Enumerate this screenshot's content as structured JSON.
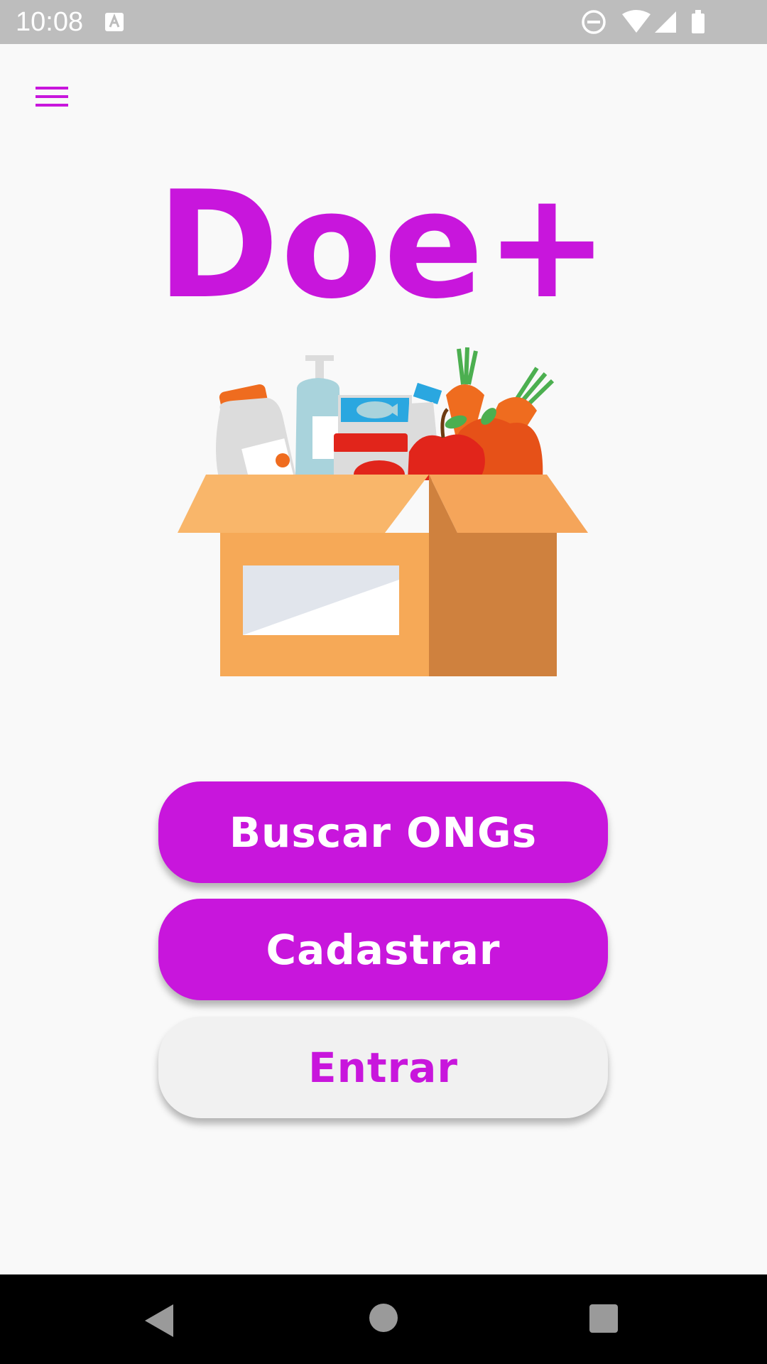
{
  "status_bar": {
    "time": "10:08",
    "notification_icon": "a-notification-icon",
    "icons": [
      "do-not-disturb-icon",
      "wifi-icon",
      "signal-icon",
      "battery-icon"
    ]
  },
  "header": {
    "menu_icon": "hamburger-menu-icon"
  },
  "app": {
    "title": "Doe+",
    "illustration": "donation-box-illustration"
  },
  "actions": {
    "search_label": "Buscar ONGs",
    "register_label": "Cadastrar",
    "login_label": "Entrar"
  },
  "colors": {
    "accent": "#c816dc",
    "background": "#f9f9f9",
    "secondary_button": "#f1f1f1"
  },
  "nav_bar": {
    "icons": [
      "back-icon",
      "home-icon",
      "recents-icon"
    ]
  }
}
